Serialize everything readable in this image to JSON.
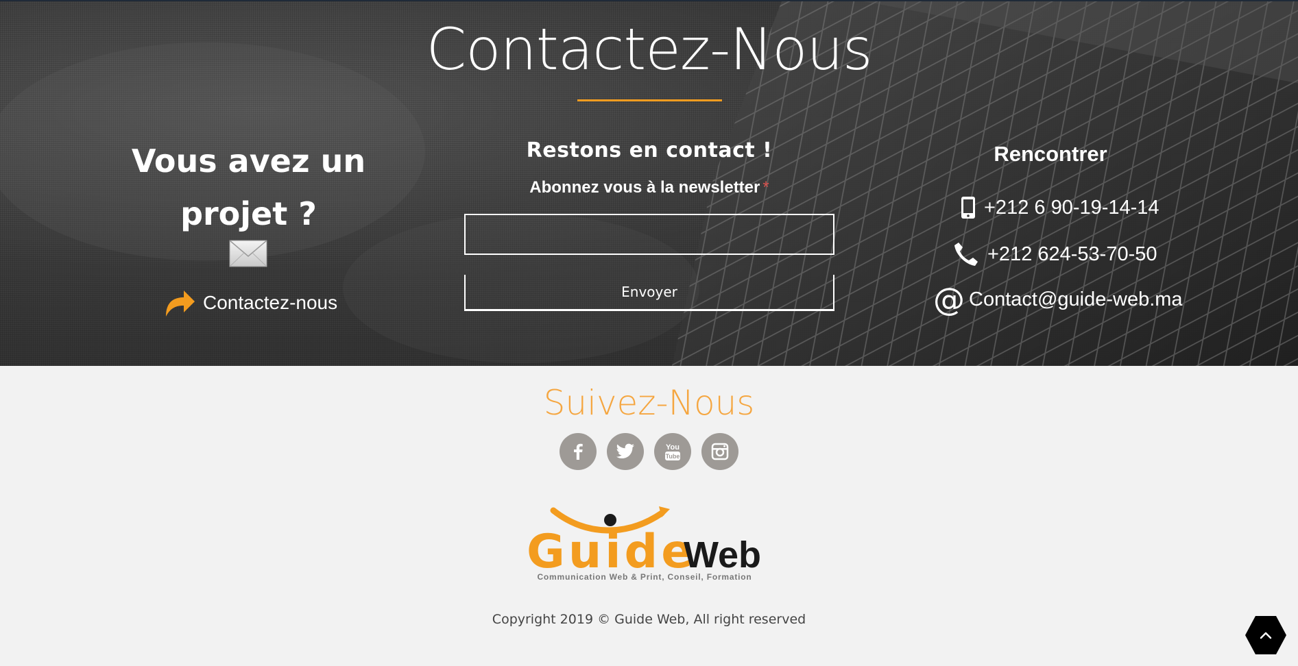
{
  "contact": {
    "title": "Contactez-Nous",
    "project": {
      "title": "Vous avez un projet ?",
      "link_label": "Contactez-nous"
    },
    "newsletter": {
      "heading": "Restons en contact !",
      "label": "Abonnez vous à la newsletter",
      "required_mark": "*",
      "email_value": "",
      "submit_label": "Envoyer"
    },
    "meet": {
      "title": "Rencontrer",
      "mobile": "+212 6 90-19-14-14",
      "phone": "+212 624-53-70-50",
      "email": "Contact@guide-web.ma"
    }
  },
  "footer": {
    "follow_title": "Suivez-Nous",
    "socials": [
      {
        "name": "facebook",
        "icon": "facebook-icon"
      },
      {
        "name": "twitter",
        "icon": "twitter-icon"
      },
      {
        "name": "youtube",
        "icon": "youtube-icon"
      },
      {
        "name": "instagram",
        "icon": "instagram-icon"
      }
    ],
    "logo": {
      "part1": "Guide",
      "part2": "Web",
      "tagline": "Communication Web & Print, Conseil, Formation"
    },
    "copyright": "Copyright 2019 © Guide Web, All right reserved"
  },
  "colors": {
    "accent": "#f39c1f",
    "hero_text": "#ffffff",
    "social_bg": "#9e9a96",
    "footer_bg": "#f2f2f2"
  }
}
